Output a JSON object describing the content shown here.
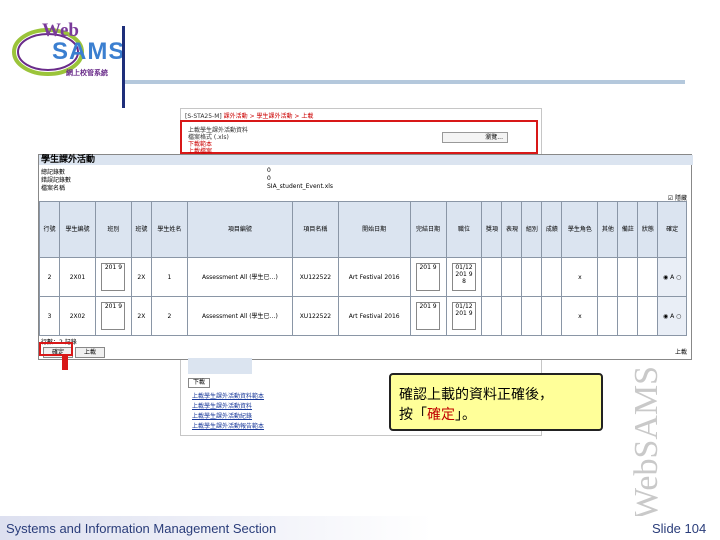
{
  "logo": {
    "line1": "Web",
    "line2": "SAMS",
    "line3": "網上校管系統"
  },
  "watermark": "WebSAMS",
  "breadcrumb": {
    "code": "[S-STA25-M]",
    "path": "課外活動 > 學生課外活動 > 上載"
  },
  "upload_section": {
    "line1": "上載學生課外活動資料",
    "line2": "檔案格式 (.xls)",
    "line3": "下載範本",
    "line4": "上載檔案",
    "file_button": "瀏覽..."
  },
  "table_panel": {
    "title": "學生課外活動",
    "info": [
      {
        "label": "總記錄數",
        "value": "0"
      },
      {
        "label": "錯誤記錄數",
        "value": "0"
      },
      {
        "label": "檔案名稱",
        "value": "SIA_student_Event.xls"
      }
    ],
    "hide_cols": "☑ 隱藏",
    "headers": [
      "行號",
      "學生編號",
      "班別",
      "班號",
      "學生姓名",
      "項目編號",
      "項目名稱",
      "開始日期",
      "完結日期",
      "職位",
      "獎項",
      "表現",
      "組別",
      "成績",
      "學生角色",
      "其他",
      "備註",
      "狀態",
      "確定"
    ],
    "rows": [
      {
        "cells": [
          "2",
          "2X01",
          "201 9",
          "2X",
          "1",
          "Assessment All (學生已…)",
          "XU122522",
          "Art Festival 2016",
          "201 9",
          "01/12 201 9 8",
          "",
          "",
          "",
          "",
          "x",
          "",
          "",
          "",
          "◉ A ○"
        ]
      },
      {
        "cells": [
          "3",
          "2X02",
          "201 9",
          "2X",
          "2",
          "Assessment All (學生已…)",
          "XU122522",
          "Art Festival 2016",
          "201 9",
          "01/12 201 9",
          "",
          "",
          "",
          "",
          "x",
          "",
          "",
          "",
          "◉ A ○"
        ]
      }
    ],
    "footer_text": "行數：2 記錄",
    "confirm_button": "確定",
    "upload_button": "上載",
    "right_label": "上載"
  },
  "lower_panel": {
    "button": "下載",
    "links": [
      "上載學生課外活動資料範本",
      "上載學生課外活動資料",
      "上載學生課外活動紀錄",
      "上載學生課外活動報告範本"
    ]
  },
  "callout": {
    "line1": "確認上載的資料正確後，",
    "prefix": "按「",
    "highlight": "確定",
    "suffix": "」。"
  },
  "footer": {
    "left": "Systems and Information Management Section",
    "right": "Slide 104"
  }
}
